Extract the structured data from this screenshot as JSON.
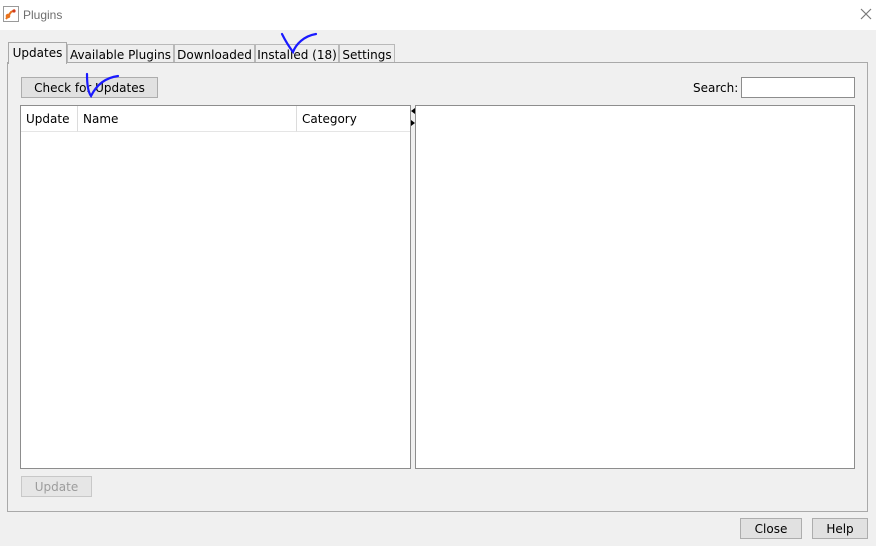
{
  "window": {
    "title": "Plugins",
    "icons": {
      "app": "plugins-app-icon",
      "close": "close-icon"
    }
  },
  "tabs": [
    {
      "label": "Updates",
      "active": true
    },
    {
      "label": "Available Plugins",
      "active": false
    },
    {
      "label": "Downloaded",
      "active": false
    },
    {
      "label": "Installed (18)",
      "active": false
    },
    {
      "label": "Settings",
      "active": false
    }
  ],
  "toolbar": {
    "check_label": "Check for Updates"
  },
  "search": {
    "label": "Search:",
    "value": ""
  },
  "table": {
    "columns": [
      "Update",
      "Name",
      "Category"
    ],
    "rows": []
  },
  "actions": {
    "update_label": "Update"
  },
  "footer": {
    "close_label": "Close",
    "help_label": "Help"
  },
  "annotations": [
    "checkmark-annotation",
    "checkmark-annotation"
  ],
  "colors": {
    "annotation_ink": "#1a1aff",
    "panel_bg": "#f0f0f0",
    "border": "#a9a9a9"
  }
}
